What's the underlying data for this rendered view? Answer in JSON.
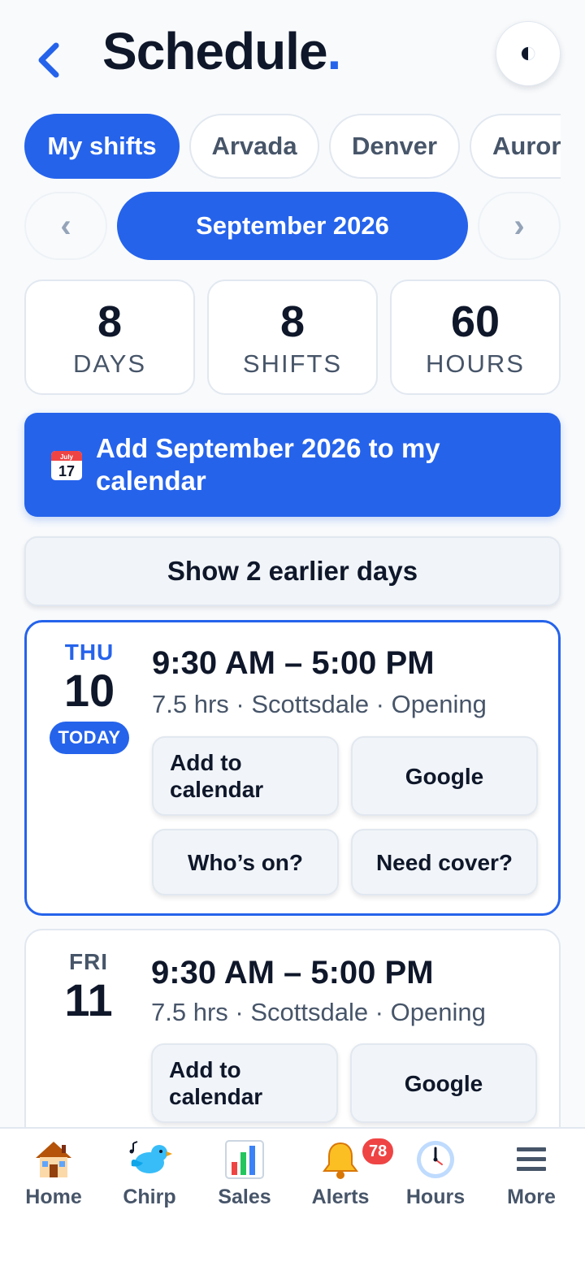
{
  "header": {
    "title": "Schedule",
    "title_dot": ".",
    "back_icon": "chevron-left-icon",
    "theme_icon": "half-moon-icon"
  },
  "locations": [
    "My shifts",
    "Arvada",
    "Denver",
    "Auror"
  ],
  "active_location": "My shifts",
  "month_nav": {
    "prev": "‹",
    "label": "September 2026",
    "next": "›"
  },
  "stats": [
    {
      "value": "8",
      "label": "DAYS"
    },
    {
      "value": "8",
      "label": "SHIFTS"
    },
    {
      "value": "60",
      "label": "HOURS"
    }
  ],
  "calendar_banner": {
    "icon": "calendar-icon",
    "icon_month": "July",
    "icon_day": "17",
    "text": "Add September 2026 to my calendar"
  },
  "earlier_button": "Show 2 earlier days",
  "shifts": [
    {
      "dow": "THU",
      "day": "10",
      "badge": "TODAY",
      "time": "9:30 AM – 5:00 PM",
      "meta": "7.5 hrs · Scottsdale · Opening",
      "actions": [
        "Add to calendar",
        "Google",
        "Who’s on?",
        "Need cover?"
      ]
    },
    {
      "dow": "FRI",
      "day": "11",
      "time": "9:30 AM – 5:00 PM",
      "meta": "7.5 hrs · Scottsdale · Opening",
      "actions": [
        "Add to calendar",
        "Google"
      ]
    }
  ],
  "bottom_nav": [
    {
      "label": "Home",
      "icon": "house-icon"
    },
    {
      "label": "Chirp",
      "icon": "bird-icon"
    },
    {
      "label": "Sales",
      "icon": "bar-chart-icon"
    },
    {
      "label": "Alerts",
      "icon": "bell-icon",
      "badge": "78"
    },
    {
      "label": "Hours",
      "icon": "clock-icon"
    },
    {
      "label": "More",
      "icon": "menu-icon"
    }
  ],
  "colors": {
    "accent": "#2563eb",
    "text": "#0f172a",
    "muted": "#475569",
    "badge": "#ef4444",
    "background": "#f8fafc"
  }
}
